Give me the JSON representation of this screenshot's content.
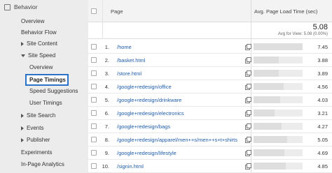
{
  "sidebar": {
    "header": "Behavior",
    "items": [
      {
        "label": "Overview"
      },
      {
        "label": "Behavior Flow"
      },
      {
        "label": "Site Content"
      },
      {
        "label": "Site Speed"
      },
      {
        "label": "Overview"
      },
      {
        "label": "Page Timings"
      },
      {
        "label": "Speed Suggestions"
      },
      {
        "label": "User Timings"
      },
      {
        "label": "Site Search"
      },
      {
        "label": "Events"
      },
      {
        "label": "Publisher"
      },
      {
        "label": "Experiments"
      },
      {
        "label": "In-Page Analytics"
      }
    ]
  },
  "table": {
    "col_page": "Page",
    "col_load": "Avg. Page Load Time (sec)",
    "summary_value": "5.08",
    "summary_sub": "Avg for View: 5.08 (0.00%)",
    "rows": [
      {
        "idx": "1.",
        "page": "/home",
        "value": "7.45",
        "frac": 1.0
      },
      {
        "idx": "2.",
        "page": "/basket.html",
        "value": "3.88",
        "frac": 0.52
      },
      {
        "idx": "3.",
        "page": "/store.html",
        "value": "3.89",
        "frac": 0.52
      },
      {
        "idx": "4.",
        "page": "/google+redesign/office",
        "value": "4.56",
        "frac": 0.61
      },
      {
        "idx": "5.",
        "page": "/google+redesign/drinkware",
        "value": "4.03",
        "frac": 0.54
      },
      {
        "idx": "6.",
        "page": "/google+redesign/electronics",
        "value": "3.21",
        "frac": 0.43
      },
      {
        "idx": "7.",
        "page": "/google+redesign/bags",
        "value": "4.27",
        "frac": 0.57
      },
      {
        "idx": "8.",
        "page": "/google+redesign/apparel/men++s/men++s+t+shirts",
        "value": "5.05",
        "frac": 0.68
      },
      {
        "idx": "9.",
        "page": "/google+redesign/lifestyle",
        "value": "4.69",
        "frac": 0.63
      },
      {
        "idx": "10.",
        "page": "/signin.html",
        "value": "4.85",
        "frac": 0.65
      }
    ]
  }
}
